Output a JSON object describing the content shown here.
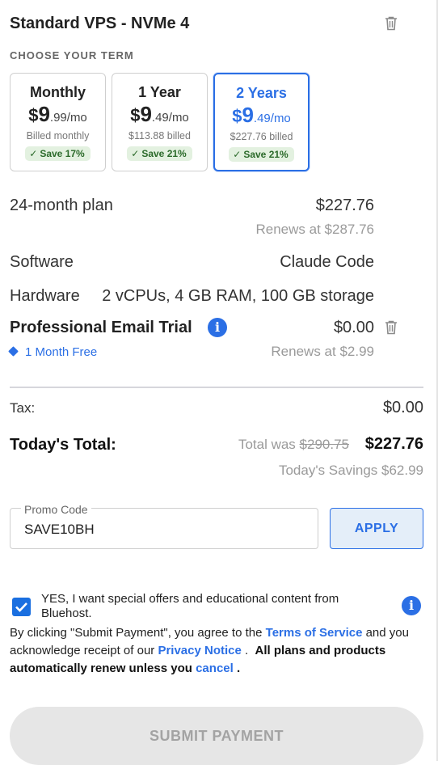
{
  "product": {
    "title": "Standard VPS - NVMe 4"
  },
  "term": {
    "label": "CHOOSE YOUR TERM",
    "options": [
      {
        "name": "Monthly",
        "currency": "$",
        "price_whole": "9",
        "price_cents": ".99/mo",
        "billed": "Billed monthly",
        "save": "Save 17%",
        "selected": false
      },
      {
        "name": "1 Year",
        "currency": "$",
        "price_whole": "9",
        "price_cents": ".49/mo",
        "billed": "$113.88 billed",
        "save": "Save 21%",
        "selected": false
      },
      {
        "name": "2 Years",
        "currency": "$",
        "price_whole": "9",
        "price_cents": ".49/mo",
        "billed": "$227.76 billed",
        "save": "Save 21%",
        "selected": true
      }
    ]
  },
  "plan": {
    "label": "24-month plan",
    "price": "$227.76",
    "renews": "Renews at $287.76"
  },
  "software": {
    "label": "Software",
    "value": "Claude Code"
  },
  "hardware": {
    "label": "Hardware",
    "value": "2 vCPUs, 4 GB RAM, 100 GB storage"
  },
  "email_trial": {
    "title": "Professional Email Trial",
    "price": "$0.00",
    "tag": "1 Month Free",
    "renews": "Renews at $2.99"
  },
  "summary": {
    "tax_label": "Tax:",
    "tax_value": "$0.00",
    "total_label": "Today's Total:",
    "total_was_label": "Total was",
    "total_was_value": "$290.75",
    "total_value": "$227.76",
    "savings": "Today's Savings $62.99"
  },
  "promo": {
    "label": "Promo Code",
    "value": "SAVE10BH",
    "apply": "APPLY"
  },
  "consent": {
    "text": "YES, I want special offers and educational content from Bluehost.",
    "checked": true
  },
  "legal": {
    "part1": "By clicking \"Submit Payment\", you agree to the",
    "tos_link": "Terms of Service",
    "part2": "and you acknowledge receipt of our",
    "privacy_link": "Privacy Notice",
    "part3": ".",
    "bold": "All plans and products automatically renew unless you",
    "cancel_link": "cancel",
    "part4": "."
  },
  "submit": {
    "label": "SUBMIT PAYMENT",
    "enabled": false
  },
  "colors": {
    "accent": "#2b6fe5",
    "save_bg": "#e3f1e0",
    "save_text": "#2b6a2a",
    "muted": "#9a9a9a"
  },
  "icons": {
    "delete": "trash-icon",
    "info": "info-icon",
    "tag": "tag-icon",
    "check": "check-icon"
  }
}
